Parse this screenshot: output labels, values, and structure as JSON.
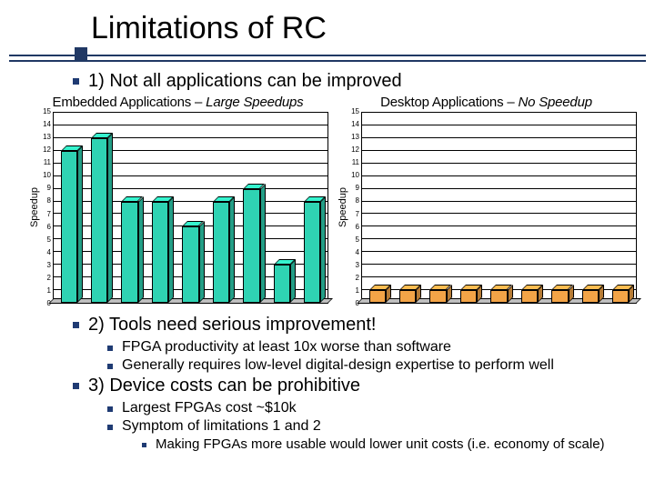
{
  "title": "Limitations of RC",
  "point1": "1) Not all applications can be improved",
  "left_chart_title_pre": "Embedded Applications – ",
  "left_chart_title_em": "Large Speedups",
  "right_chart_title_pre": "Desktop Applications – ",
  "right_chart_title_em": "No Speedup",
  "ylabel": "Speedup",
  "point2": "2) Tools need serious improvement!",
  "point2_a": "FPGA productivity at least 10x worse than software",
  "point2_b": "Generally requires low-level digital-design expertise to perform well",
  "point3": "3) Device costs can be prohibitive",
  "point3_a": "Largest FPGAs cost ~$10k",
  "point3_b": "Symptom of limitations 1 and 2",
  "point3_b_i": "Making FPGAs more usable would lower unit costs (i.e. economy of scale)",
  "chart_data": [
    {
      "type": "bar",
      "title": "Embedded Applications – Large Speedups",
      "ylabel": "Speedup",
      "ylim": [
        0,
        15
      ],
      "yticks": [
        0,
        1,
        2,
        3,
        4,
        5,
        6,
        7,
        8,
        9,
        10,
        11,
        12,
        13,
        14,
        15
      ],
      "categories": [
        "",
        "",
        "",
        "",
        "",
        "",
        "",
        "",
        ""
      ],
      "values": [
        12,
        13,
        8,
        8,
        6,
        8,
        9,
        3,
        8
      ],
      "bar_color": "#2fd3b3"
    },
    {
      "type": "bar",
      "title": "Desktop Applications – No Speedup",
      "ylabel": "Speedup",
      "ylim": [
        0,
        15
      ],
      "yticks": [
        0,
        1,
        2,
        3,
        4,
        5,
        6,
        7,
        8,
        9,
        10,
        11,
        12,
        13,
        14,
        15
      ],
      "categories": [
        "",
        "",
        "",
        "",
        "",
        "",
        "",
        "",
        ""
      ],
      "values": [
        1,
        1,
        1,
        1,
        1,
        1,
        1,
        1,
        1
      ],
      "bar_color": "#f3a447"
    }
  ]
}
